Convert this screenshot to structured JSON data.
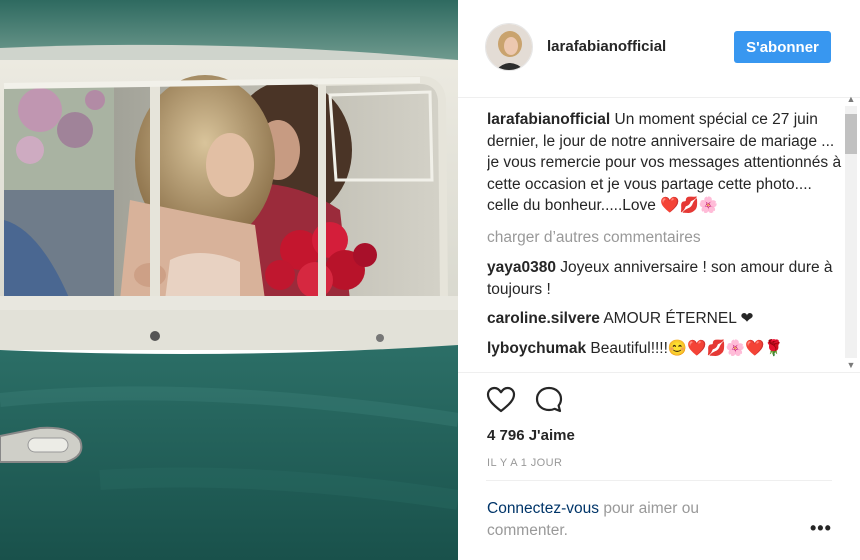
{
  "post": {
    "username": "larafabianofficial",
    "follow_label": "S'abonner",
    "caption": {
      "username": "larafabianofficial",
      "text": "Un moment spécial ce 27 juin dernier, le jour de notre anniversaire de mariage ... je vous remercie pour vos messages attentionnés à cette occasion et je vous partage cette photo.... celle du bonheur.....Love ❤️💋🌸"
    },
    "load_more": "charger d’autres commentaires",
    "comments": [
      {
        "username": "yaya0380",
        "text": "Joyeux anniversaire ! son amour dure à toujours !"
      },
      {
        "username": "caroline.silvere",
        "text": "AMOUR ÉTERNEL ❤"
      },
      {
        "username": "lyboychumak",
        "text": "Beautiful!!!!😊❤️💋🌸❤️🌹"
      }
    ],
    "likes": "4 796 J'aime",
    "timestamp": "IL Y A 1 JOUR",
    "login": {
      "link": "Connectez-vous",
      "text": " pour aimer ou commenter."
    },
    "more_options": "•••"
  },
  "colors": {
    "accent": "#3897f0",
    "link": "#003569",
    "muted": "#999999",
    "van_teal": "#1f5e58"
  },
  "icons": {
    "like": "heart-outline-icon",
    "comment": "speech-bubble-icon",
    "more": "ellipsis-icon"
  }
}
